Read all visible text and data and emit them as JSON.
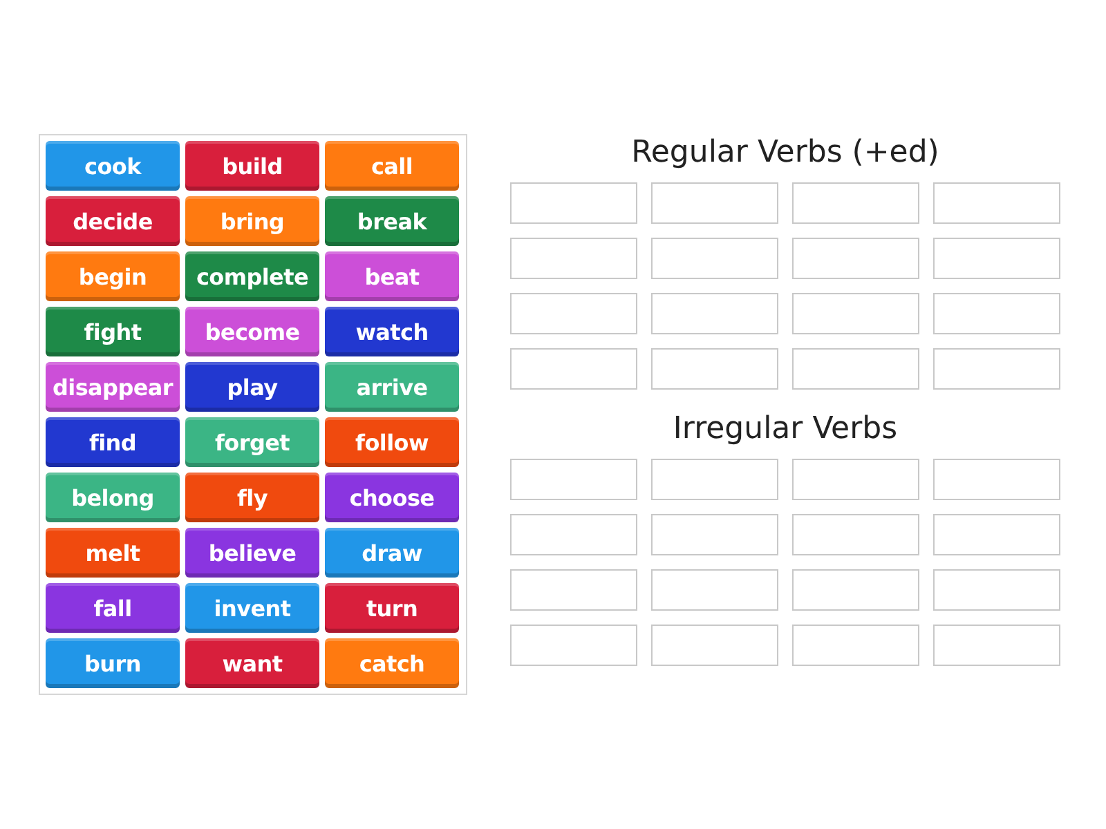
{
  "tiles": [
    {
      "label": "cook",
      "color": "#2196e8"
    },
    {
      "label": "build",
      "color": "#d81f3c"
    },
    {
      "label": "call",
      "color": "#ff7a10"
    },
    {
      "label": "decide",
      "color": "#d81f3c"
    },
    {
      "label": "bring",
      "color": "#ff7a10"
    },
    {
      "label": "break",
      "color": "#1e8a48"
    },
    {
      "label": "begin",
      "color": "#ff7a10"
    },
    {
      "label": "complete",
      "color": "#1e8a48"
    },
    {
      "label": "beat",
      "color": "#cc4fd8"
    },
    {
      "label": "fight",
      "color": "#1e8a48"
    },
    {
      "label": "become",
      "color": "#cc4fd8"
    },
    {
      "label": "watch",
      "color": "#2238d0"
    },
    {
      "label": "disappear",
      "color": "#cc4fd8"
    },
    {
      "label": "play",
      "color": "#2238d0"
    },
    {
      "label": "arrive",
      "color": "#3bb585"
    },
    {
      "label": "find",
      "color": "#2238d0"
    },
    {
      "label": "forget",
      "color": "#3bb585"
    },
    {
      "label": "follow",
      "color": "#f04a0e"
    },
    {
      "label": "belong",
      "color": "#3bb585"
    },
    {
      "label": "fly",
      "color": "#f04a0e"
    },
    {
      "label": "choose",
      "color": "#8a35e0"
    },
    {
      "label": "melt",
      "color": "#f04a0e"
    },
    {
      "label": "believe",
      "color": "#8a35e0"
    },
    {
      "label": "draw",
      "color": "#2196e8"
    },
    {
      "label": "fall",
      "color": "#8a35e0"
    },
    {
      "label": "invent",
      "color": "#2196e8"
    },
    {
      "label": "turn",
      "color": "#d81f3c"
    },
    {
      "label": "burn",
      "color": "#2196e8"
    },
    {
      "label": "want",
      "color": "#d81f3c"
    },
    {
      "label": "catch",
      "color": "#ff7a10"
    }
  ],
  "groups": [
    {
      "title": "Regular Verbs (+ed)",
      "slots": [
        {
          "filled": false
        },
        {
          "filled": false
        },
        {
          "filled": false
        },
        {
          "filled": false
        },
        {
          "filled": false
        },
        {
          "filled": false
        },
        {
          "filled": false
        },
        {
          "filled": false
        },
        {
          "filled": false
        },
        {
          "filled": false
        },
        {
          "filled": false
        },
        {
          "filled": false
        },
        {
          "filled": false
        },
        {
          "filled": false
        },
        {
          "filled": false
        },
        {
          "filled": false
        }
      ]
    },
    {
      "title": "Irregular Verbs",
      "slots": [
        {
          "filled": false
        },
        {
          "filled": false
        },
        {
          "filled": false
        },
        {
          "filled": false
        },
        {
          "filled": false
        },
        {
          "filled": false
        },
        {
          "filled": false
        },
        {
          "filled": false
        },
        {
          "filled": false
        },
        {
          "filled": false
        },
        {
          "filled": false
        },
        {
          "filled": false
        },
        {
          "filled": false
        },
        {
          "filled": false
        },
        {
          "filled": false
        },
        {
          "filled": false
        }
      ]
    }
  ]
}
